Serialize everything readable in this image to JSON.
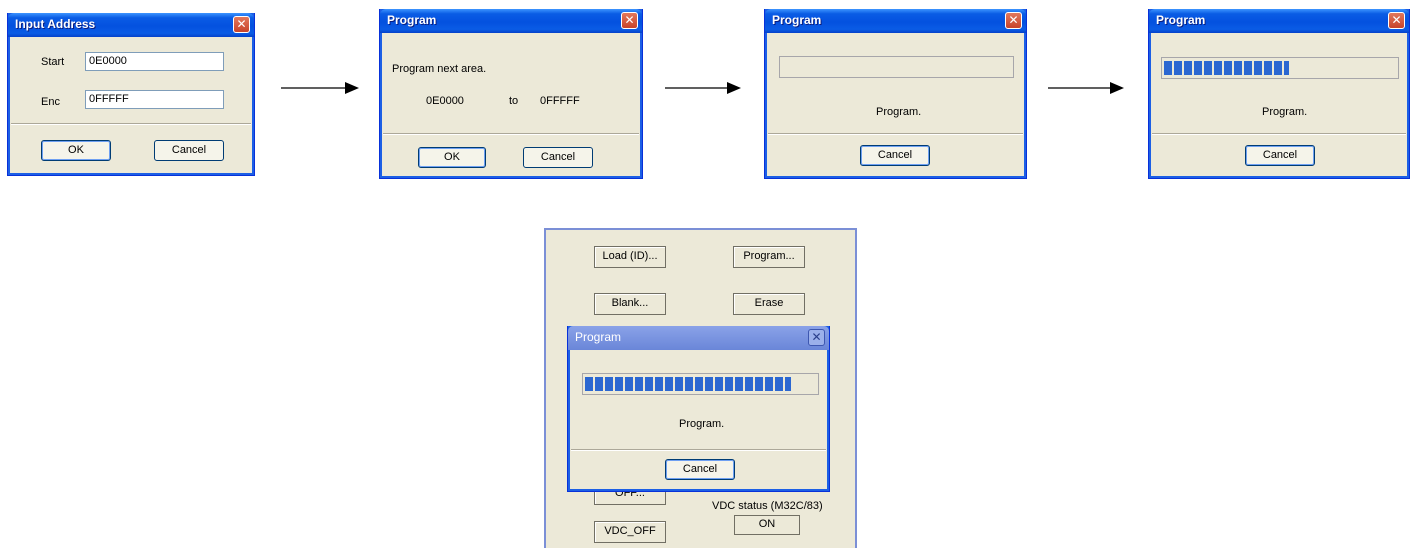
{
  "input_dialog": {
    "title": "Input Address",
    "start_label": "Start",
    "start_value": "0E0000",
    "end_label": "Enc",
    "end_value": "0FFFFF",
    "ok_label": "OK",
    "cancel_label": "Cancel"
  },
  "confirm_dialog": {
    "title": "Program",
    "message": "Program next area.",
    "from_value": "0E0000",
    "to_label": "to",
    "to_value": "0FFFFF",
    "ok_label": "OK",
    "cancel_label": "Cancel"
  },
  "progress_dialog_start": {
    "title": "Program",
    "status": "Program.",
    "cancel_label": "Cancel",
    "progress_fraction": 0.0
  },
  "progress_dialog_mid": {
    "title": "Program",
    "status": "Program.",
    "cancel_label": "Cancel",
    "progress_fraction": 0.54
  },
  "main_panel": {
    "load_label": "Load (ID)...",
    "program_label": "Program...",
    "blank_label": "Blank...",
    "erase_label": "Erase",
    "hidden_button_label": "OFF...",
    "vdc_status_label": "VDC status (M32C/83)",
    "vdc_status_value": "ON",
    "vdc_off_label": "VDC_OFF"
  },
  "overlay_dialog": {
    "title": "Program",
    "status": "Program.",
    "cancel_label": "Cancel",
    "progress_fraction": 0.89
  },
  "colors": {
    "title_blue": "#0a5ce5",
    "progress_blue": "#2b67d1",
    "dialog_bg": "#ece9d8",
    "close_red": "#d5573c"
  },
  "icons": [
    "close-icon",
    "arrow-right-icon"
  ]
}
